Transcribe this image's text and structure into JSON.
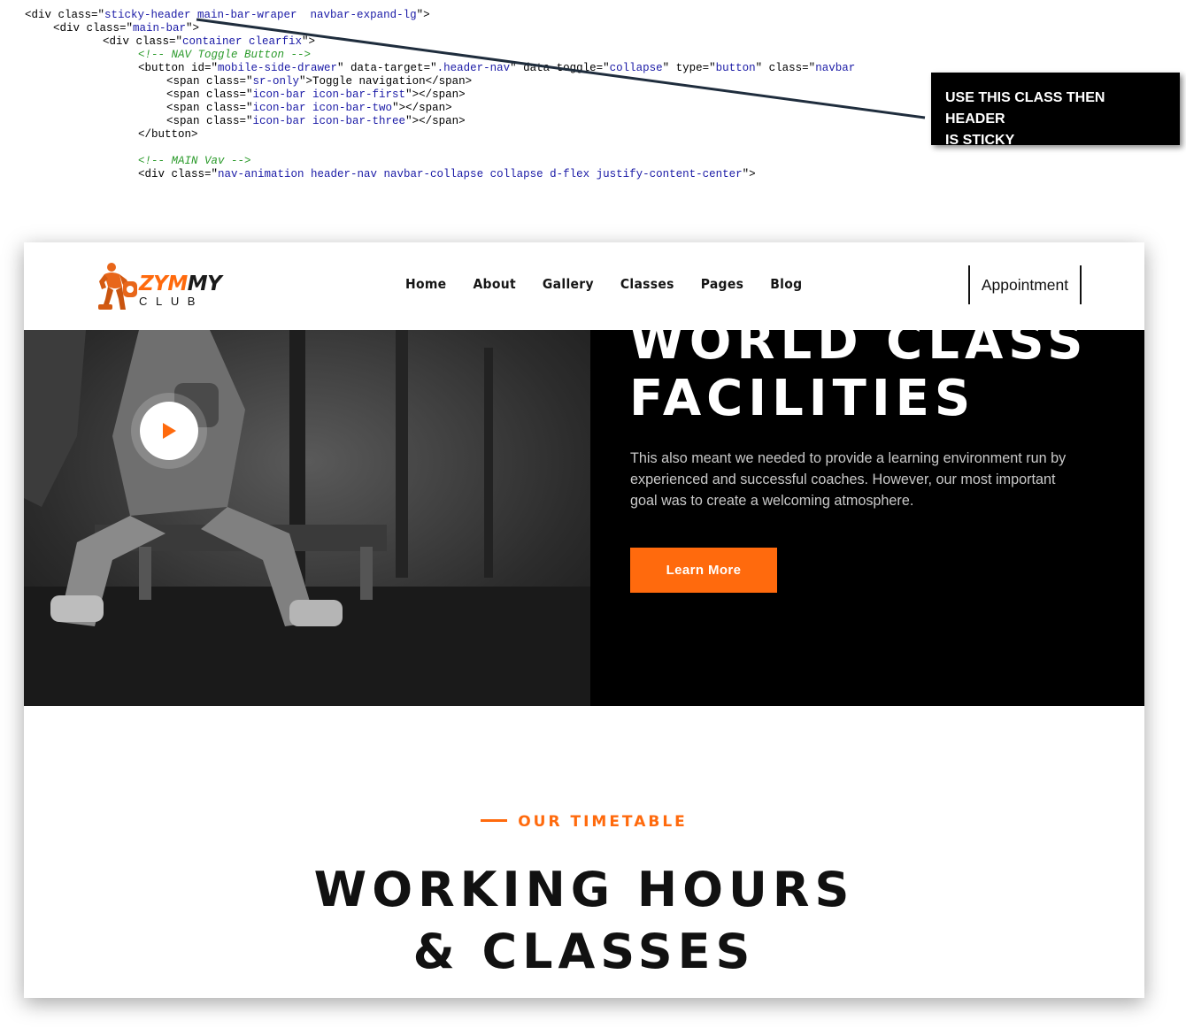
{
  "code": {
    "l1": {
      "a": "<div class=\"",
      "cls": "sticky-header main-bar-wraper  navbar-expand-lg",
      "b": "\">"
    },
    "l2": {
      "a": "<div class=\"",
      "cls": "main-bar",
      "b": "\">"
    },
    "l3": {
      "a": "<div class=\"",
      "cls": "container clearfix",
      "b": "\">"
    },
    "l4": "<!-- NAV Toggle Button -->",
    "l5": {
      "a": "<button id=\"",
      "v1": "mobile-side-drawer",
      "b": "\" data-target=\"",
      "v2": ".header-nav",
      "c": "\" data-toggle=\"",
      "v3": "collapse",
      "d": "\" type=\"",
      "v4": "button",
      "e": "\" class=\"",
      "v5": "navbar"
    },
    "l6": {
      "a": "<span class=\"",
      "cls": "sr-only",
      "b": "\">Toggle navigation</span>"
    },
    "l7": {
      "a": "<span class=\"",
      "cls": "icon-bar icon-bar-first",
      "b": "\"></span>"
    },
    "l8": {
      "a": "<span class=\"",
      "cls": "icon-bar icon-bar-two",
      "b": "\"></span>"
    },
    "l9": {
      "a": "<span class=\"",
      "cls": "icon-bar icon-bar-three",
      "b": "\"></span>"
    },
    "l10": "</button>",
    "l11": "<!-- MAIN Vav -->",
    "l12": {
      "a": "<div class=\"",
      "cls": "nav-animation header-nav navbar-collapse collapse d-flex justify-content-center",
      "b": "\">"
    }
  },
  "callout": {
    "line1": "USE THIS CLASS THEN HEADER",
    "line2": "IS STICKY"
  },
  "site": {
    "logo": {
      "brand_a": "ZYM",
      "brand_b": "MY",
      "sub": "CLUB"
    },
    "menu": [
      "Home",
      "About",
      "Gallery",
      "Classes",
      "Pages",
      "Blog"
    ],
    "appointment": "Appointment",
    "hero": {
      "title1": "WORLD CLASS",
      "title2": "FACILITIES",
      "text": "This also meant we needed to provide a learning environment run by experienced and successful coaches. However, our most important goal was to create a welcoming atmosphere.",
      "button": "Learn More"
    },
    "section": {
      "kicker": "OUR TIMETABLE",
      "title1": "WORKING HOURS",
      "title2": "& CLASSES"
    }
  },
  "colors": {
    "accent": "#ff6a0d",
    "dark": "#000000"
  }
}
